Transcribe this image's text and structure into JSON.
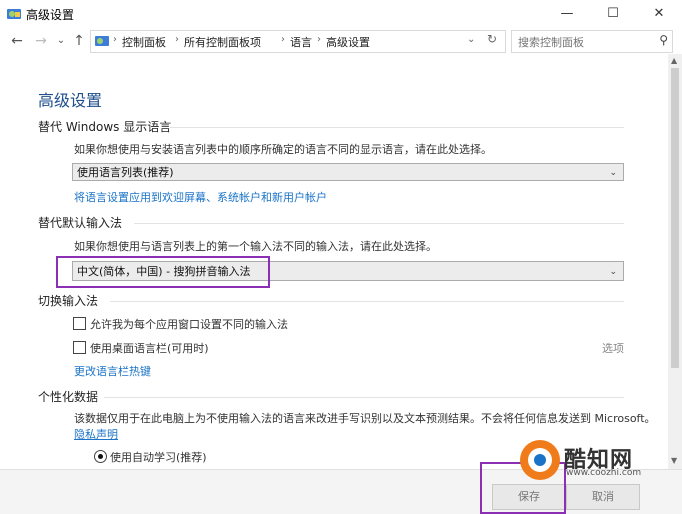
{
  "window": {
    "title": "高级设置",
    "minimize": "—",
    "maximize": "☐",
    "close": "✕"
  },
  "address": {
    "back": "←",
    "forward": "→",
    "dropdown": "⌄",
    "up": "↑",
    "refresh": "↻",
    "crumbs": [
      "控制面板",
      "所有控制面板项",
      "语言",
      "高级设置"
    ],
    "search_placeholder": "搜索控制面板",
    "search_icon": "⚲"
  },
  "page": {
    "heading": "高级设置"
  },
  "display_lang": {
    "title": "替代 Windows 显示语言",
    "desc": "如果你想使用与安装语言列表中的顺序所确定的语言不同的显示语言，请在此处选择。",
    "selected": "使用语言列表(推荐)",
    "link": "将语言设置应用到欢迎屏幕、系统帐户和新用户帐户"
  },
  "default_input": {
    "title": "替代默认输入法",
    "desc": "如果你想使用与语言列表上的第一个输入法不同的输入法，请在此处选择。",
    "selected": "中文(简体，中国) - 搜狗拼音输入法"
  },
  "switch_input": {
    "title": "切换输入法",
    "opt1": "允许我为每个应用窗口设置不同的输入法",
    "opt2": "使用桌面语言栏(可用时)",
    "options_link": "选项",
    "hotkeys_link": "更改语言栏热键"
  },
  "personal_data": {
    "title": "个性化数据",
    "desc": "该数据仅用于在此电脑上为不使用输入法的语言来改进手写识别以及文本预测结果。不会将任何信息发送到 Microsoft。",
    "privacy_link": "隐私声明",
    "radio1": "使用自动学习(推荐)"
  },
  "footer": {
    "ok": "保存",
    "cancel": "取消"
  },
  "watermark": {
    "name": "酷知网",
    "url": "www.coozhi.com"
  },
  "colors": {
    "highlight": "#8b2fb5",
    "link": "#1a73c7",
    "heading": "#1e4e8c"
  }
}
